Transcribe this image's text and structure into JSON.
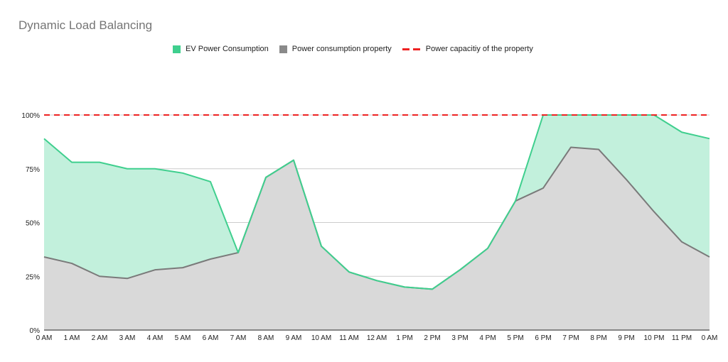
{
  "chart_data": {
    "type": "area",
    "title": "Dynamic Load Balancing",
    "xlabel": "",
    "ylabel": "",
    "ylim": [
      0,
      100
    ],
    "y_ticks": [
      "0%",
      "25%",
      "50%",
      "75%",
      "100%"
    ],
    "y_tick_values": [
      0,
      25,
      50,
      75,
      100
    ],
    "grid": true,
    "legend_position": "top",
    "categories": [
      "0 AM",
      "1 AM",
      "2 AM",
      "3 AM",
      "4 AM",
      "5 AM",
      "6 AM",
      "7 AM",
      "8 AM",
      "9 AM",
      "10 AM",
      "11 AM",
      "12 AM",
      "1 PM",
      "2 PM",
      "3 PM",
      "4 PM",
      "5 PM",
      "6 PM",
      "7 PM",
      "8 PM",
      "9 PM",
      "10 PM",
      "11 PM",
      "0 AM"
    ],
    "series": [
      {
        "name": "EV Power Consumption",
        "type": "area",
        "color": "#3fcf8e",
        "fill": "#c2f0dc",
        "values": [
          89,
          78,
          78,
          75,
          75,
          73,
          69,
          36,
          71,
          79,
          39,
          27,
          23,
          20,
          19,
          28,
          38,
          60,
          100,
          100,
          100,
          100,
          100,
          92,
          89
        ]
      },
      {
        "name": "Power consumption property",
        "type": "area",
        "color": "#7a7a7a",
        "fill": "#d9d9d9",
        "values": [
          34,
          31,
          25,
          24,
          28,
          29,
          33,
          36,
          71,
          79,
          39,
          27,
          23,
          20,
          19,
          28,
          38,
          60,
          66,
          85,
          84,
          70,
          55,
          41,
          34
        ]
      },
      {
        "name": "Power capacitiy of the property",
        "type": "line",
        "style": "dashed",
        "color": "#ee2222",
        "values": [
          100,
          100,
          100,
          100,
          100,
          100,
          100,
          100,
          100,
          100,
          100,
          100,
          100,
          100,
          100,
          100,
          100,
          100,
          100,
          100,
          100,
          100,
          100,
          100,
          100
        ]
      }
    ]
  }
}
